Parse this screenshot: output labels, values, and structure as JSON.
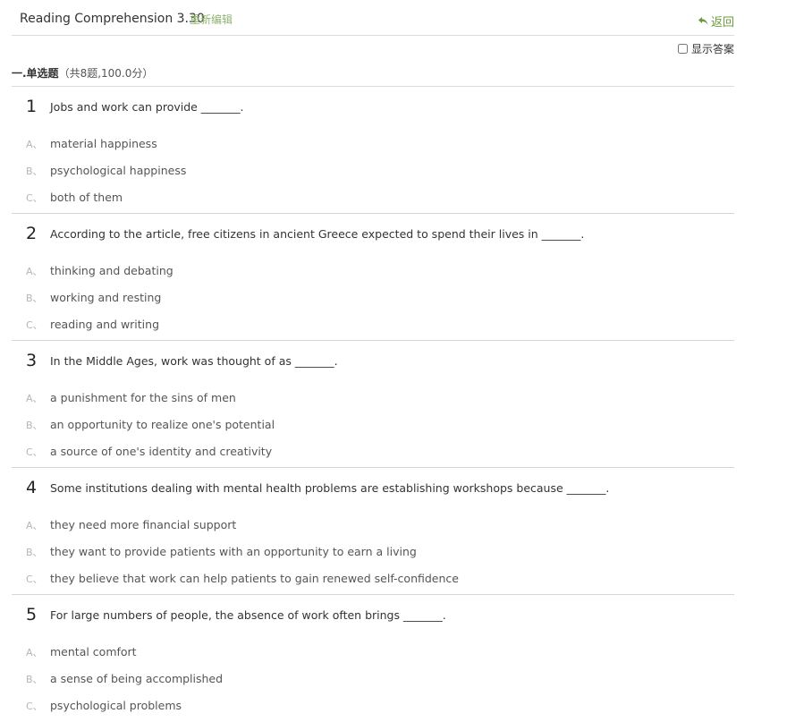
{
  "header": {
    "title": "Reading Comprehension 3.30",
    "reedit_label": "重新编辑",
    "back_label": "返回",
    "show_answer_label": "显示答案",
    "show_answer_checked": false
  },
  "section": {
    "title": "一.单选题",
    "meta": "（共8题,100.0分）"
  },
  "questions": [
    {
      "number": "1",
      "text": "Jobs and work can provide _______.",
      "options": [
        {
          "letter": "A、",
          "text": "material happiness"
        },
        {
          "letter": "B、",
          "text": "psychological happiness"
        },
        {
          "letter": "C、",
          "text": "both of them"
        }
      ]
    },
    {
      "number": "2",
      "text": "According to the article, free citizens in ancient Greece expected to spend their lives in _______.",
      "options": [
        {
          "letter": "A、",
          "text": "thinking and debating"
        },
        {
          "letter": "B、",
          "text": "working and resting"
        },
        {
          "letter": "C、",
          "text": "reading and writing"
        }
      ]
    },
    {
      "number": "3",
      "text": "In the Middle Ages, work was thought of as _______.",
      "options": [
        {
          "letter": "A、",
          "text": "a punishment for the sins of men"
        },
        {
          "letter": "B、",
          "text": "an opportunity to realize one's potential"
        },
        {
          "letter": "C、",
          "text": "a source of one's identity and creativity"
        }
      ]
    },
    {
      "number": "4",
      "text": "Some institutions dealing with mental health problems are establishing workshops because _______.",
      "options": [
        {
          "letter": "A、",
          "text": "they need more financial support"
        },
        {
          "letter": "B、",
          "text": "they want to provide patients with an opportunity to earn a living"
        },
        {
          "letter": "C、",
          "text": "they believe that work can help patients to gain renewed self-confidence"
        }
      ]
    },
    {
      "number": "5",
      "text": "For large numbers of people, the absence of work often brings _______.",
      "options": [
        {
          "letter": "A、",
          "text": "mental comfort"
        },
        {
          "letter": "B、",
          "text": "a sense of being accomplished"
        },
        {
          "letter": "C、",
          "text": "psychological problems"
        }
      ]
    }
  ],
  "colors": {
    "accent_green": "#6a9a3e",
    "reedit_green": "#8fb36f",
    "divider": "#dcdcdc"
  }
}
